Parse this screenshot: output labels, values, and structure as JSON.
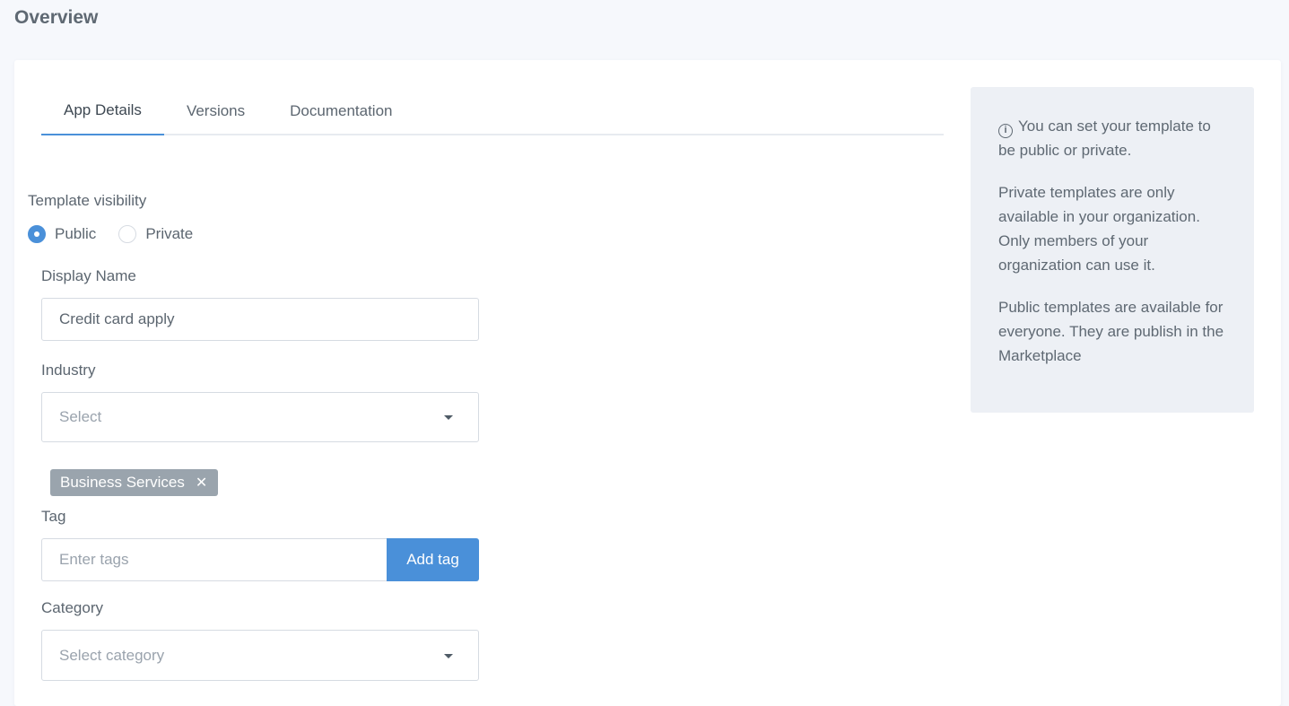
{
  "page": {
    "title": "Overview"
  },
  "tabs": [
    {
      "label": "App Details",
      "active": true
    },
    {
      "label": "Versions",
      "active": false
    },
    {
      "label": "Documentation",
      "active": false
    }
  ],
  "visibility": {
    "label": "Template visibility",
    "options": [
      {
        "label": "Public",
        "checked": true
      },
      {
        "label": "Private",
        "checked": false
      }
    ]
  },
  "display_name": {
    "label": "Display Name",
    "value": "Credit card apply"
  },
  "industry": {
    "label": "Industry",
    "placeholder": "Select",
    "selected_chips": [
      "Business Services"
    ]
  },
  "tag": {
    "label": "Tag",
    "placeholder": "Enter tags",
    "button_label": "Add tag"
  },
  "category": {
    "label": "Category",
    "placeholder": "Select category"
  },
  "info": {
    "icon": "info-circle-icon",
    "paragraphs": [
      "You can set your template to be public or private.",
      "Private templates are only available in your organization. Only members of your organization can use it.",
      "Public templates are available for everyone. They are publish in the Marketplace"
    ]
  },
  "colors": {
    "accent": "#4a90d9",
    "chip": "#9aa4ad",
    "info_background": "#edf0f5",
    "page_background": "#f6f8fc"
  }
}
